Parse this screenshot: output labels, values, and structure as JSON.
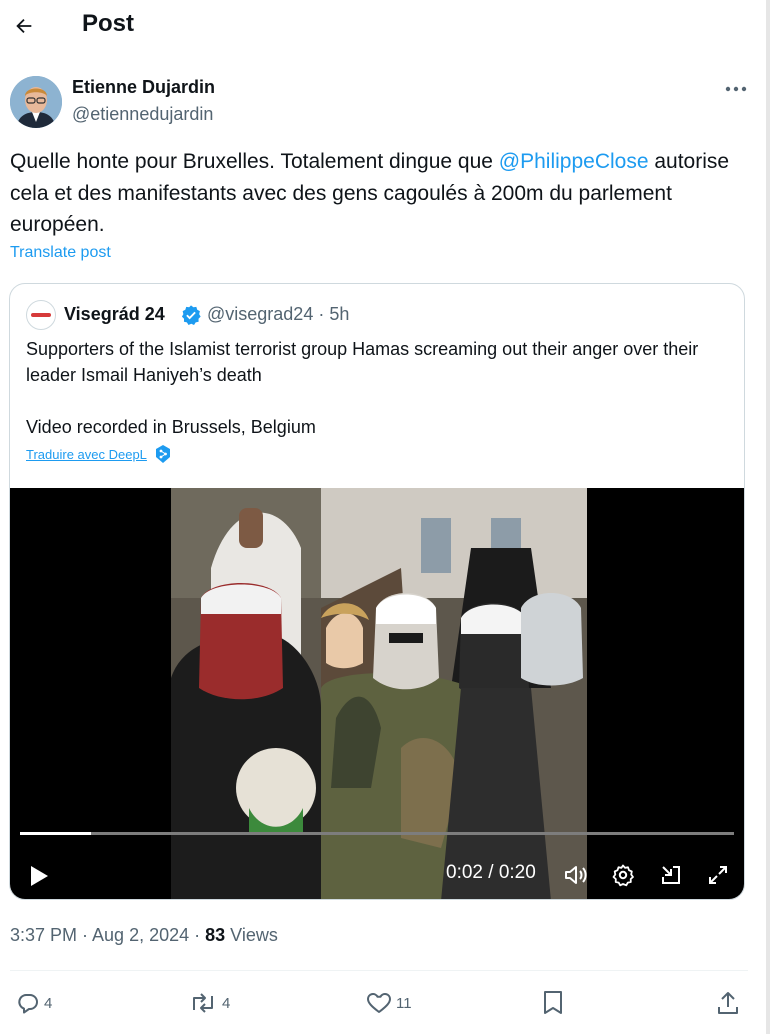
{
  "header": {
    "title": "Post"
  },
  "author": {
    "name": "Etienne Dujardin",
    "handle": "@etiennedujardin"
  },
  "tweet": {
    "text_before": "Quelle honte pour Bruxelles. Totalement dingue que ",
    "mention": "@PhilippeClose",
    "text_after": " autorise cela et des manifestants avec des gens cagoulés à 200m du parlement européen.",
    "translate": "Translate post"
  },
  "quote": {
    "name": "Visegrád 24",
    "handle_time": "@visegrad24 · 5h",
    "text1": "Supporters of the Islamist terrorist group Hamas screaming out their anger over their leader Ismail Haniyeh’s death",
    "text2": "Video recorded in Brussels, Belgium",
    "translate": "Traduire avec DeepL",
    "video": {
      "time": "0:02 / 0:20",
      "progress": 0.1
    }
  },
  "meta": {
    "time": "3:37 PM · Aug 2, 2024 · ",
    "views_count": "83",
    "views_label": " Views"
  },
  "actions": {
    "replies": "4",
    "reposts": "4",
    "likes": "11"
  },
  "colors": {
    "accent": "#1d9bf0",
    "muted": "#536471",
    "text": "#0f1419"
  }
}
